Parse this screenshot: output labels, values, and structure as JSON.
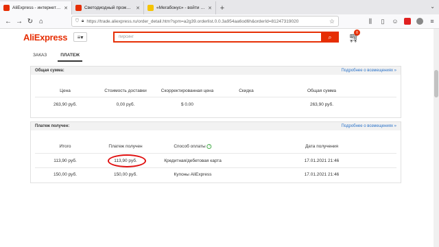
{
  "browser": {
    "tabs": [
      {
        "title": "AliExpress - интернет-магазин",
        "color": "#e62e04",
        "active": true
      },
      {
        "title": "Светодиодный прожектор, уп",
        "color": "#e62e04",
        "active": false
      },
      {
        "title": "«Мегабонус» - войти в личн",
        "color": "#f5c400",
        "active": false
      }
    ],
    "new_tab": "+",
    "url": "https://trade.aliexpress.ru/order_detail.htm?spm=a2g39.orderlist.0.0.3a954aa6od6h&orderId=81247319020"
  },
  "site": {
    "logo": "AliExpress",
    "search_placeholder": "пирсинг",
    "cart_count": "0"
  },
  "order_tabs": [
    {
      "label": "ЗАКАЗ",
      "active": false
    },
    {
      "label": "ПЛАТЕЖ",
      "active": true
    }
  ],
  "total_panel": {
    "title": "Общая сумма:",
    "link": "Подробнее о возмещениях »",
    "headers": [
      "Цена",
      "Стоимость доставки",
      "Скорректированная цена",
      "Скидка",
      "Общая сумма"
    ],
    "values": [
      "263,90 руб.",
      "0,00 руб.",
      "$ 0.00",
      "",
      "263,90 руб."
    ]
  },
  "payment_panel": {
    "title": "Платеж получен:",
    "link": "Подробнее о возмещениях »",
    "headers": [
      "Итого",
      "Платеж получен",
      "Способ оплаты",
      "Дата получения"
    ],
    "rows": [
      [
        "113,90 руб.",
        "113,90 руб.",
        "Кредитная/дебетовая карта",
        "17.01.2021 21:46"
      ],
      [
        "150,00 руб.",
        "150,00 руб.",
        "Купоны AliExpress",
        "17.01.2021 21:46"
      ]
    ],
    "highlight_color": "#e01010"
  }
}
